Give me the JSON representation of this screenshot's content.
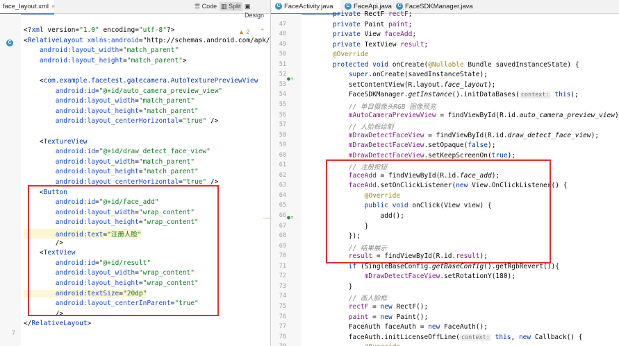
{
  "left_editor": {
    "tab": {
      "label": "face_layout.xml",
      "close": "×"
    },
    "view_modes": [
      "Code",
      "Split",
      "Design"
    ],
    "selected_mode": "Split",
    "warnings": "▲ 2",
    "line_numbers": [
      "",
      "",
      "",
      "",
      "",
      "",
      "",
      "",
      "",
      "",
      "",
      "",
      "",
      "",
      "",
      "",
      "",
      "",
      "",
      "",
      "",
      "",
      "",
      "",
      "",
      "",
      "",
      "",
      "",
      "",
      "7",
      "",
      "",
      ""
    ],
    "lines": [
      [
        "<?xml version=\"1.0\" encoding=\"utf-8\"?>"
      ],
      [
        "<RelativeLayout xmlns:android=\"http://schemas.android.com/apk/res/an"
      ],
      [
        "    android:layout_width=\"match_parent\""
      ],
      [
        "    android:layout_height=\"match_parent\">"
      ],
      [
        ""
      ],
      [
        "    <com.example.facetest.gatecamera.AutoTexturePreviewView"
      ],
      [
        "        android:id=\"@+id/auto_camera_preview_view\""
      ],
      [
        "        android:layout_width=\"match_parent\""
      ],
      [
        "        android:layout_height=\"match_parent\""
      ],
      [
        "        android:layout_centerHorizontal=\"true\" />"
      ],
      [
        ""
      ],
      [
        "    <TextureView"
      ],
      [
        "        android:id=\"@+id/draw_detect_face_view\""
      ],
      [
        "        android:layout_width=\"match_parent\""
      ],
      [
        "        android:layout_height=\"match_parent\""
      ],
      [
        "        android:layout_centerHorizontal=\"true\" />"
      ],
      [
        "    <Button"
      ],
      [
        "        android:id=\"@+id/face_add\""
      ],
      [
        "        android:layout_width=\"wrap_content\""
      ],
      [
        "        android:layout_height=\"wrap_content\""
      ],
      [
        "        android:text=\"注册人脸\""
      ],
      [
        "        />"
      ],
      [
        "    <TextView"
      ],
      [
        "        android:id=\"@+id/result\""
      ],
      [
        "        android:layout_width=\"wrap_content\""
      ],
      [
        "        android:layout_height=\"wrap_content\""
      ],
      [
        "        android:textSize=\"20dp\""
      ],
      [
        "        android:layout_centerInParent=\"true\""
      ],
      [
        "        />"
      ],
      [
        "</RelativeLayout>"
      ]
    ]
  },
  "right_editor": {
    "tabs": [
      {
        "label": "FaceActivity.java"
      },
      {
        "label": "FaceApi.java"
      },
      {
        "label": "FaceSDKManager.java"
      }
    ],
    "line_numbers": [
      "",
      "47",
      "48",
      "49",
      "50",
      "51",
      "52",
      "53",
      "54",
      "55",
      "56",
      "57",
      "58",
      "59",
      "60",
      "61",
      "62",
      "63",
      "64",
      "65",
      "66",
      "67",
      "68",
      "69",
      "70",
      "71",
      "72",
      "73",
      "74",
      "75",
      "76",
      "77",
      "78",
      "79"
    ],
    "lines": [
      "    private RectF rectF;",
      "    private Paint paint;",
      "    private View faceAdd;",
      "    private TextView result;",
      "    @Override",
      "    protected void onCreate(@Nullable Bundle savedInstanceState) {",
      "        super.onCreate(savedInstanceState);",
      "        setContentView(R.layout.face_layout);",
      "        FaceSDKManager.getInstance().initDataBases( context: this);",
      "        // 单目摄像头RGB 图像预览",
      "        mAutoCameraPreviewView = findViewById(R.id.auto_camera_preview_view);",
      "        // 人脸框绘制",
      "        mDrawDetectFaceView = findViewById(R.id.draw_detect_face_view);",
      "        mDrawDetectFaceView.setOpaque(false);",
      "        mDrawDetectFaceView.setKeepScreenOn(true);",
      "        // 注册按钮",
      "        faceAdd = findViewById(R.id.face_add);",
      "        faceAdd.setOnClickListener(new View.OnClickListener() {",
      "            @Override",
      "            public void onClick(View view) {",
      "                add();",
      "            }",
      "        });",
      "        // 结果展示",
      "        result = findViewById(R.id.result);",
      "        if (SingleBaseConfig.getBaseConfig().getRgbRevert()){",
      "            mDrawDetectFaceView.setRotationY(180);",
      "        }",
      "        // 画人脸框",
      "        rectF = new RectF();",
      "        paint = new Paint();",
      "        FaceAuth faceAuth = new FaceAuth();",
      "        faceAuth.initLicenseOffLine( context: this, new Callback() {",
      "            @Override"
    ]
  }
}
